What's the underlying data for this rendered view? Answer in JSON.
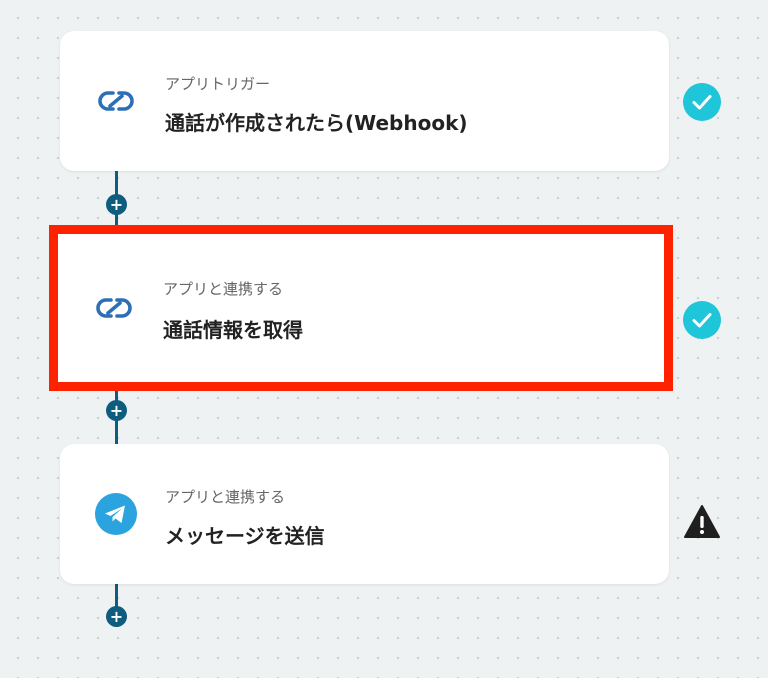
{
  "steps": [
    {
      "type_label": "アプリトリガー",
      "title": "通話が作成されたら(Webhook)",
      "app_icon": "zoho-link-icon",
      "status": "check-icon"
    },
    {
      "type_label": "アプリと連携する",
      "title": "通話情報を取得",
      "app_icon": "zoho-link-icon",
      "status": "check-icon",
      "highlighted": true
    },
    {
      "type_label": "アプリと連携する",
      "title": "メッセージを送信",
      "app_icon": "telegram-icon",
      "status": "warning-icon"
    }
  ],
  "add_step_symbol": "+",
  "colors": {
    "connector": "#0e5c7e",
    "check": "#1fc5d8",
    "warning": "#1f1f1f",
    "highlight": "#ff2200",
    "link_icon": "#2d6fb7",
    "telegram": "#2aa3df"
  }
}
